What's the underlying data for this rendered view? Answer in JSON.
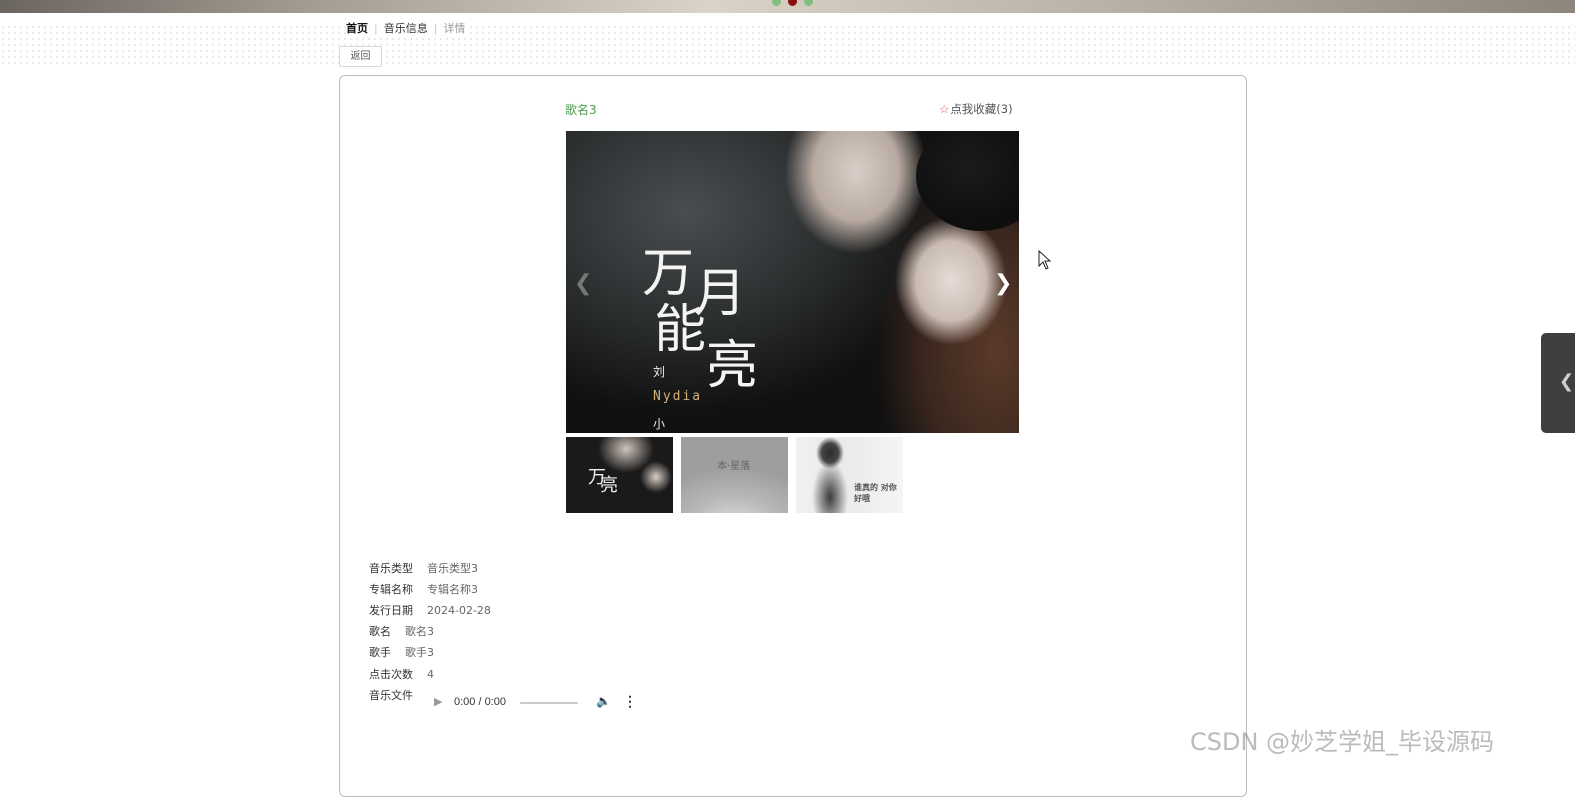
{
  "breadcrumb": {
    "home": "首页",
    "music_info": "音乐信息",
    "detail": "详情",
    "separator": "|"
  },
  "back_button": "返回",
  "song": {
    "title": "歌名3",
    "favorite_label": "点我收藏(3)"
  },
  "cover_text": {
    "line1": "万",
    "line2": "月",
    "line3": "能",
    "line4": "亮",
    "artist_liu": "刘",
    "artist_en": "Nydia",
    "artist_xiao": "小"
  },
  "thumb_texts": {
    "thumb2": "本·星落",
    "thumb3": "谁真的 对你好哦"
  },
  "details": [
    {
      "label": "音乐类型",
      "value": "音乐类型3"
    },
    {
      "label": "专辑名称",
      "value": "专辑名称3"
    },
    {
      "label": "发行日期",
      "value": "2024-02-28"
    },
    {
      "label": "歌名",
      "value": "歌名3"
    },
    {
      "label": "歌手",
      "value": "歌手3"
    },
    {
      "label": "点击次数",
      "value": "4"
    },
    {
      "label": "音乐文件",
      "value": ""
    }
  ],
  "player": {
    "time": "0:00 / 0:00"
  },
  "icons": {
    "star": "star-outline-icon",
    "prev": "chevron-left-icon",
    "next": "chevron-right-icon",
    "play": "play-icon",
    "volume": "volume-icon",
    "more": "more-vertical-icon",
    "side": "chevron-left-icon"
  },
  "watermark": "CSDN @妙芝学姐_毕设源码",
  "colors": {
    "title_green": "#4f9a4f",
    "star_red": "#d9534f"
  }
}
